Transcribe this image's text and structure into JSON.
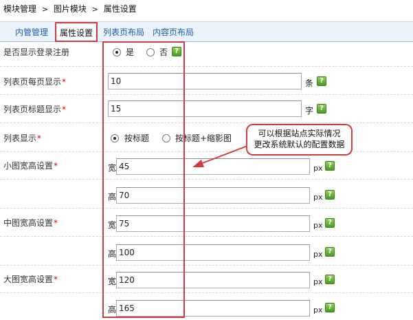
{
  "breadcrumb": {
    "item1": "模块管理",
    "sep": ">",
    "item2": "图片模块",
    "item3": "属性设置"
  },
  "tabs": {
    "t1": "内管管理",
    "t2": "属性设置",
    "t3": "列表页布局",
    "t4": "内容页布局"
  },
  "rows": {
    "login": {
      "label": "是否显示登录注册",
      "yes": "是",
      "no": "否",
      "selected": "yes"
    },
    "per_page": {
      "label": "列表页每页显示",
      "value": "10",
      "unit": "条"
    },
    "title_len": {
      "label": "列表页标题显示",
      "value": "15",
      "unit": "字"
    },
    "list_show": {
      "label": "列表显示",
      "opt1": "按标题",
      "opt2": "按标题+缩影图",
      "selected": "opt1"
    },
    "small": {
      "label": "小图宽高设置",
      "width_prefix": "宽",
      "width": "45",
      "height_prefix": "高",
      "height": "70",
      "unit": "px"
    },
    "medium": {
      "label": "中图宽高设置",
      "width_prefix": "宽",
      "width": "75",
      "height_prefix": "高",
      "height": "100",
      "unit": "px"
    },
    "large": {
      "label": "大图宽高设置",
      "width_prefix": "宽",
      "width": "120",
      "height_prefix": "高",
      "height": "165",
      "unit": "px"
    }
  },
  "required_mark": "*",
  "help_glyph": "?",
  "callout": {
    "line1": "可以根据站点实际情况",
    "line2": "更改系统默认的配置数据"
  },
  "colors": {
    "accent_red": "#d23b3b",
    "tab_link": "#1f5ea8",
    "help_green": "#4c9a24",
    "tabbar_bg": "#eaf3fb"
  }
}
